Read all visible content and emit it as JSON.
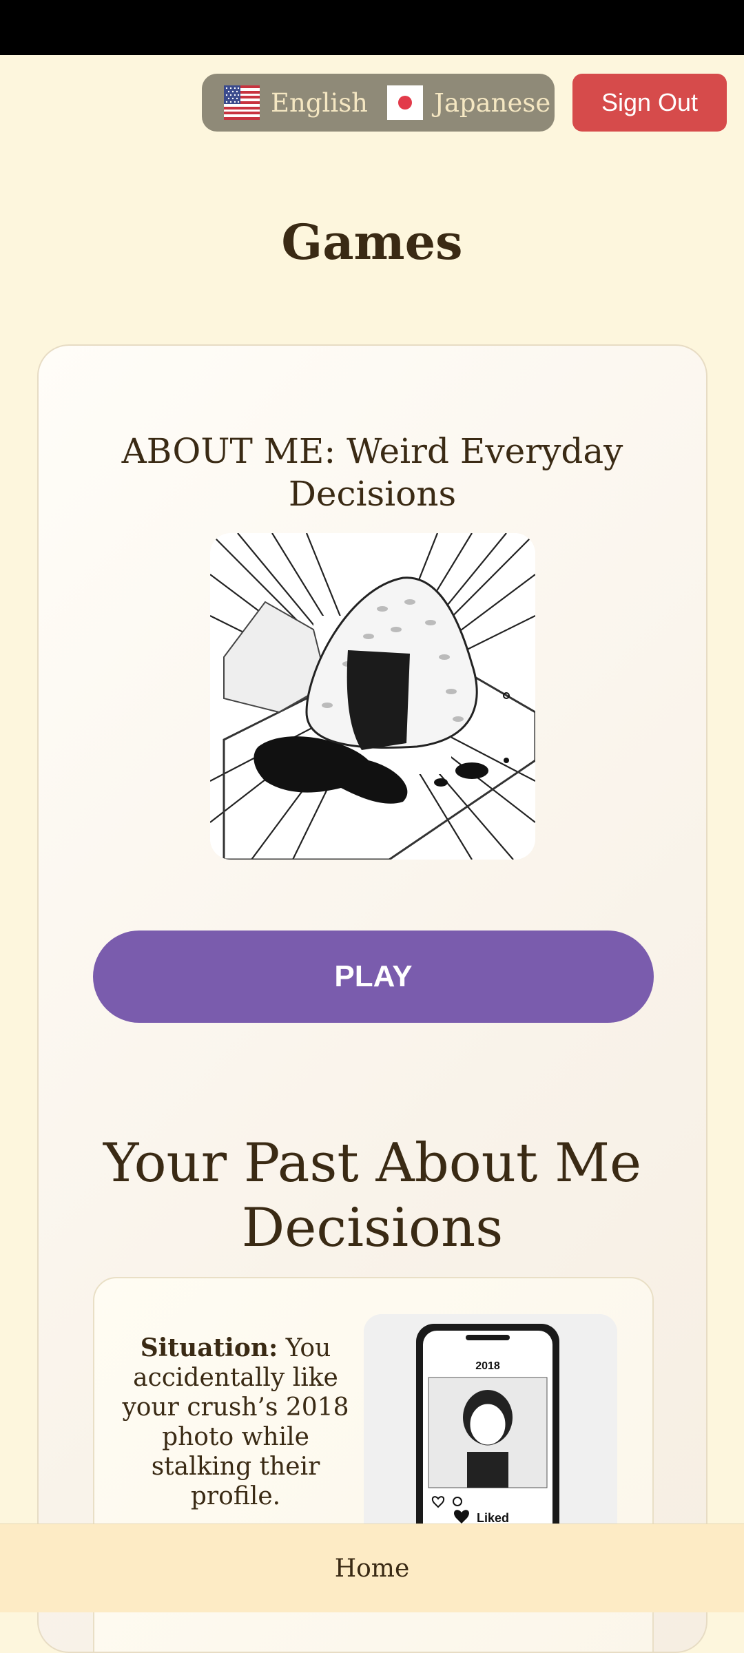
{
  "header": {
    "languages": [
      {
        "label": "English",
        "icon": "us-flag-icon"
      },
      {
        "label": "Japanese",
        "icon": "japan-flag-icon"
      }
    ],
    "sign_out_label": "Sign Out"
  },
  "page": {
    "title": "Games"
  },
  "game": {
    "title": "ABOUT ME: Weird Everyday Decisions",
    "image": "onigiri-soy-sauce-illustration",
    "play_label": "PLAY"
  },
  "past_decisions": {
    "title": "Your Past About Me Decisions",
    "items": [
      {
        "situation_label": "Situation:",
        "situation_text": "You accidentally like your crush’s 2018 photo while stalking their profile.",
        "image": "phone-liked-photo-illustration",
        "image_year": "2018",
        "image_liked_label": "Liked"
      }
    ]
  },
  "bottom_nav": {
    "home_label": "Home"
  },
  "colors": {
    "background": "#fdf6dd",
    "language_pill": "#8f8a78",
    "sign_out": "#d64b4b",
    "play_button": "#7a5cad",
    "nav_background": "#fdebc5"
  }
}
